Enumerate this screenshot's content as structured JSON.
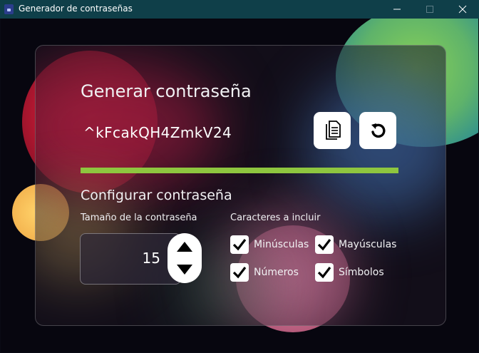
{
  "window": {
    "title": "Generador de contraseñas",
    "minimize_icon": "minimize-icon",
    "maximize_icon": "maximize-icon",
    "close_icon": "close-icon"
  },
  "generator": {
    "heading": "Generar contraseña",
    "password": "^kFcakQH4ZmkV24",
    "copy_icon": "copy-icon",
    "refresh_icon": "refresh-icon",
    "strength_fraction": 1.0,
    "strength_color": "#8ec63f"
  },
  "config": {
    "heading": "Configurar contraseña",
    "length_label": "Tamaño de la contraseña",
    "length_value": "15",
    "chars_label": "Caracteres a incluir",
    "options": [
      {
        "label": "Minúsculas",
        "checked": true
      },
      {
        "label": "Mayúsculas",
        "checked": true
      },
      {
        "label": "Números",
        "checked": true
      },
      {
        "label": "Símbolos",
        "checked": true
      }
    ]
  }
}
